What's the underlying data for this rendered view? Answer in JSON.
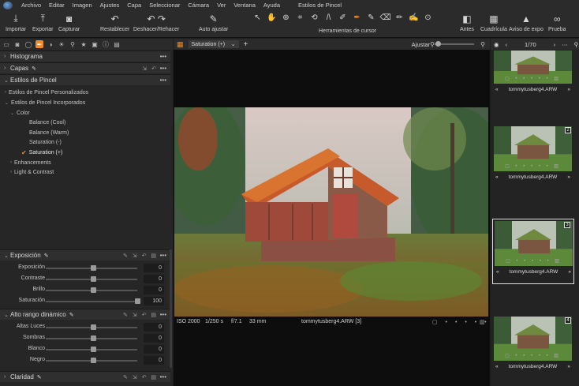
{
  "menu": {
    "items": [
      "Archivo",
      "Editar",
      "Imagen",
      "Ajustes",
      "Capa",
      "Seleccionar",
      "Cámara",
      "Ver",
      "Ventana",
      "Ayuda"
    ],
    "window_title": "Estilos de Pincel"
  },
  "toolbar": {
    "import": "Importar",
    "export": "Exportar",
    "capture": "Capturar",
    "reset": "Restablecer",
    "undo_redo": "Deshacer/Rehacer",
    "auto_adjust": "Auto ajustar",
    "cursor_tools": "Herramientas de cursor",
    "before": "Antes",
    "grid": "Cuadrícula",
    "exposure_warning": "Aviso de expo",
    "proof": "Prueba"
  },
  "left_panel": {
    "histogram": "Histograma",
    "layers": "Capas",
    "brush_styles": "Estilos de Pincel",
    "custom_styles": "Estilos de Pincel Personalizados",
    "builtin_styles": "Estilos de Pincel Incorporados",
    "color_group": "Color",
    "styles": [
      "Balance (Cool)",
      "Balance (Warm)",
      "Saturation (-)",
      "Saturation (+)"
    ],
    "enhancements": "Enhancements",
    "light_contrast": "Light & Contrast",
    "exposure_section": "Exposición",
    "exposure_sliders": [
      {
        "label": "Exposición",
        "value": "0",
        "pos": 0.5
      },
      {
        "label": "Contraste",
        "value": "0",
        "pos": 0.5
      },
      {
        "label": "Brillo",
        "value": "0",
        "pos": 0.5
      },
      {
        "label": "Saturación",
        "value": "100",
        "pos": 1.0
      }
    ],
    "hdr_section": "Alto rango dinámico",
    "hdr_sliders": [
      {
        "label": "Altas Luces",
        "value": "0",
        "pos": 0.5
      },
      {
        "label": "Sombras",
        "value": "0",
        "pos": 0.5
      },
      {
        "label": "Blanco",
        "value": "0",
        "pos": 0.5
      },
      {
        "label": "Negro",
        "value": "0",
        "pos": 0.5
      }
    ],
    "clarity_section": "Claridad"
  },
  "viewer": {
    "style_dropdown": "Saturation (+)",
    "adjust_label": "Ajustar",
    "iso": "ISO 2000",
    "shutter": "1/250 s",
    "aperture": "f/7.1",
    "focal": "33 mm",
    "filename": "tommytusberg4.ARW [3]"
  },
  "browser": {
    "counter": "1/70",
    "thumbs": [
      {
        "name": "tommytusberg4.ARW",
        "badge": ""
      },
      {
        "name": "tommytusberg4.ARW",
        "badge": "2"
      },
      {
        "name": "tommytusberg4.ARW",
        "badge": "3"
      },
      {
        "name": "tommytusberg4.ARW",
        "badge": "4"
      }
    ]
  },
  "colors": {
    "accent": "#f08a24",
    "panel": "#262626",
    "viewer_bg": "#0d0d0d"
  }
}
